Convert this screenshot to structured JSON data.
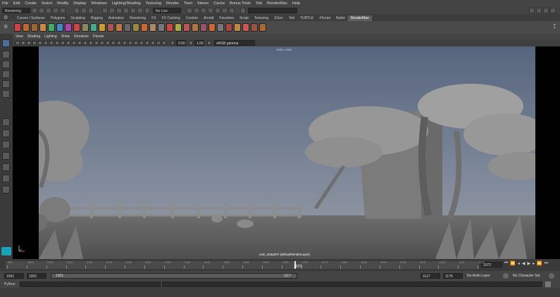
{
  "menu": [
    "File",
    "Edit",
    "Create",
    "Select",
    "Modify",
    "Display",
    "Windows",
    "Lighting/Shading",
    "Texturing",
    "Render",
    "Toon",
    "Stereo",
    "Cache",
    "Bonus Tools",
    "Yeti",
    "RenderMan",
    "Help"
  ],
  "status": {
    "menuset": "Rendering",
    "live_surface": "No Live Surface"
  },
  "shelf_tabs": [
    "Curves / Surfaces",
    "Polygons",
    "Sculpting",
    "Rigging",
    "Animation",
    "Rendering",
    "FX",
    "FX Caching",
    "Custom",
    "Arnold",
    "Favorites",
    "Script",
    "Texturing",
    "XGen",
    "Yeti",
    "TURTLE",
    "rfScript",
    "Bullet",
    "RenderMan"
  ],
  "shelf_active": "RenderMan",
  "panel_menu": [
    "View",
    "Shading",
    "Lighting",
    "Show",
    "Renderer",
    "Panels"
  ],
  "panel_tools": {
    "exposure": "0.00",
    "gamma": "1.00",
    "color_space": "sRGB gamma"
  },
  "viewport": {
    "resolution": "1090 x 1090",
    "camera_label": "cam_s04p007 (defaultRenderLayer)"
  },
  "timeline": {
    "ticks": [
      "995",
      "1000",
      "1005",
      "1010",
      "1015",
      "1020",
      "1025",
      "1030",
      "1035",
      "1040",
      "1045",
      "1050",
      "1055",
      "1060",
      "1065",
      "1070",
      "1075",
      "1080",
      "1085",
      "1090",
      "1095",
      "1100",
      "1105",
      "1110",
      "1115"
    ],
    "current_frame": "1072",
    "current_field": "1072"
  },
  "range": {
    "start": "1001",
    "start_anim": "1001",
    "range_start": "1001",
    "range_end": "1117",
    "end": "1117",
    "end_anim": "1176",
    "anim_layer": "No Anim Layer",
    "char_set": "No Character Set"
  },
  "cmdline": {
    "label": "Python"
  }
}
